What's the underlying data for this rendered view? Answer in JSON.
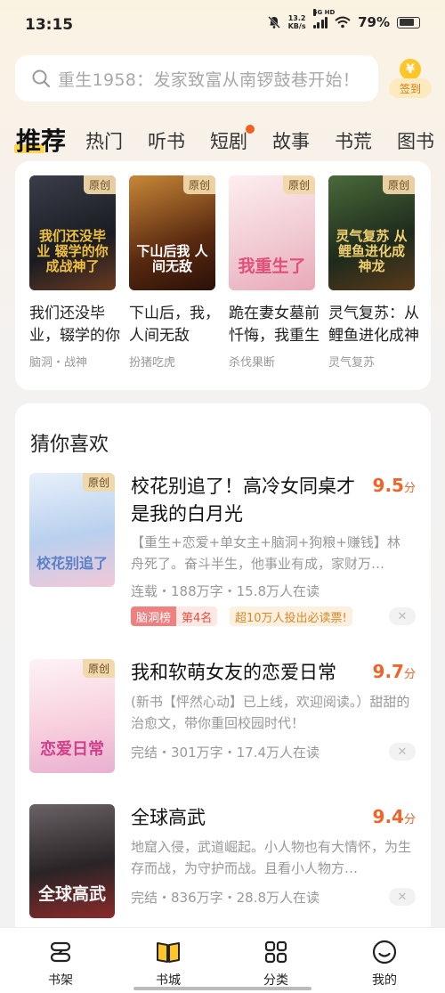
{
  "status": {
    "time": "13:15",
    "net_speed_top": "13.2",
    "net_speed_bottom": "KB/s",
    "signal_label": "5G HD",
    "battery": "79%",
    "battery_level": 0.79
  },
  "search": {
    "placeholder": "重生1958：发家致富从南锣鼓巷开始！"
  },
  "signin": {
    "coin": "¥",
    "label": "签到"
  },
  "tabs": [
    "推荐",
    "热门",
    "听书",
    "短剧",
    "故事",
    "书荒",
    "图书"
  ],
  "recommend": [
    {
      "badge": "原创",
      "cover_text": "我们还没毕业 辍学的你成战神了",
      "title": "我们还没毕业，辍学的你成战神了",
      "tag": "脑洞・战神",
      "cover_color": "#2a2c35",
      "accent": "#f0c040"
    },
    {
      "badge": "原创",
      "cover_text": "下山后我 人间无敌",
      "title": "下山后，我，人间无敌",
      "tag": "扮猪吃虎",
      "cover_color": "#5a3018",
      "accent": "#ffffff"
    },
    {
      "badge": "原创",
      "cover_text": "我重生了",
      "title": "跪在妻女墓前忏悔，我重生了",
      "tag": "杀伐果断",
      "cover_color": "#f4dce0",
      "accent": "#e0507a"
    },
    {
      "badge": "原创",
      "cover_text": "灵气复苏 从鲤鱼进化成神龙",
      "title": "灵气复苏：从鲤鱼进化成神龙",
      "tag": "灵气复苏",
      "cover_color": "#2c3a2a",
      "accent": "#f0d070"
    }
  ],
  "guess": {
    "title": "猜你喜欢",
    "books": [
      {
        "badge": "原创",
        "cover_text": "校花别追了",
        "title": "校花别追了！高冷女同桌才是我的白月光",
        "score": "9.5",
        "score_unit": "分",
        "desc": "【重生+恋爱+单女主+脑洞+狗粮+赚钱】林舟死了。奋斗半生，他事业有成，家财万…",
        "meta": "连载・188万字・15.8万人在读",
        "rank_label": "脑洞榜",
        "rank_value": "第4名",
        "vote": "超10万人投出必读票!",
        "cover_color": "#c8d8f0"
      },
      {
        "badge": "原创",
        "cover_text": "恋爱日常",
        "title": "我和软萌女友的恋爱日常",
        "score": "9.7",
        "score_unit": "分",
        "desc": "(新书【怦然心动】已上线，欢迎阅读。）甜甜的治愈文，带你重回校园时代！",
        "meta": "完结・301万字・17.4万人在读",
        "cover_color": "#fbe6ee"
      },
      {
        "badge": "",
        "cover_text": "全球高武",
        "title": "全球高武",
        "score": "9.4",
        "score_unit": "分",
        "desc": "地窟入侵，武道崛起。小人物也有大情怀，为生存而战，为守护而战。且看小人物方…",
        "meta": "完结・836万字・28.8万人在读",
        "cover_color": "#3a3436"
      }
    ]
  },
  "nav": [
    {
      "label": "书架",
      "icon": "bookshelf-icon"
    },
    {
      "label": "书城",
      "icon": "bookstore-icon",
      "active": true
    },
    {
      "label": "分类",
      "icon": "category-icon"
    },
    {
      "label": "我的",
      "icon": "profile-icon"
    }
  ]
}
